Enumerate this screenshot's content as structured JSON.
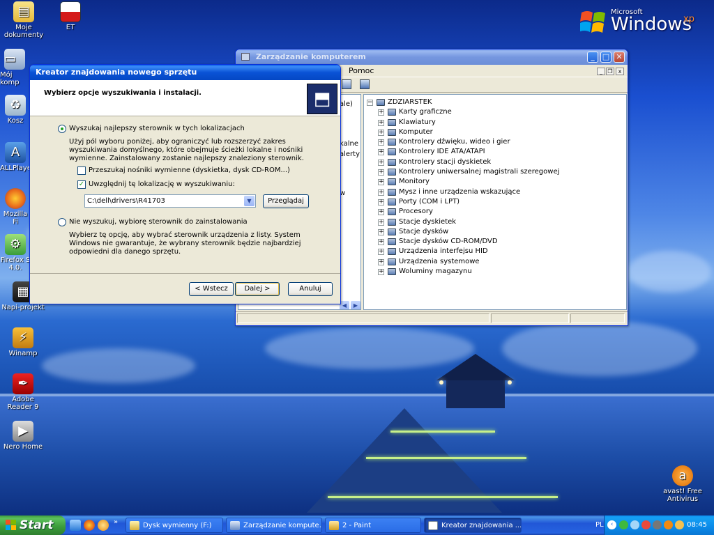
{
  "desktop": {
    "icons": [
      {
        "label": "Moje dokumenty",
        "icon": "my-documents-icon"
      },
      {
        "label": "ET",
        "icon": "flag-icon"
      },
      {
        "label": "Mój komp",
        "icon": "my-computer-icon"
      },
      {
        "label": "Kosz",
        "icon": "recycle-bin-icon"
      },
      {
        "label": "ALLPlayer",
        "icon": "allplayer-icon"
      },
      {
        "label": "Mozilla Fi",
        "icon": "firefox-icon"
      },
      {
        "label": "Firefox S 4.0.",
        "icon": "firefox-setup-icon"
      },
      {
        "label": "Napi-projekt",
        "icon": "napiprojekt-icon"
      },
      {
        "label": "Winamp",
        "icon": "winamp-icon"
      },
      {
        "label": "Adobe Reader 9",
        "icon": "adobe-reader-icon"
      },
      {
        "label": "Nero Home",
        "icon": "nero-icon"
      },
      {
        "label": "avast! Free Antivirus",
        "icon": "avast-icon"
      }
    ],
    "logo": {
      "ms": "Microsoft",
      "win": "Windows",
      "xp": "xp"
    }
  },
  "mmc": {
    "title": "Zarządzanie komputerem",
    "menu_help": "Pomoc",
    "left_fragments": [
      "ale)",
      "kalne",
      "alerty",
      "w"
    ],
    "root": "ZDZIARSTEK",
    "items": [
      "Karty graficzne",
      "Klawiatury",
      "Komputer",
      "Kontrolery dźwięku, wideo i gier",
      "Kontrolery IDE ATA/ATAPI",
      "Kontrolery stacji dyskietek",
      "Kontrolery uniwersalnej magistrali szeregowej",
      "Monitory",
      "Mysz i inne urządzenia wskazujące",
      "Porty (COM i LPT)",
      "Procesory",
      "Stacje dyskietek",
      "Stacje dysków",
      "Stacje dysków CD-ROM/DVD",
      "Urządzenia interfejsu HID",
      "Urządzenia systemowe",
      "Woluminy magazynu"
    ]
  },
  "wizard": {
    "title": "Kreator znajdowania nowego sprzętu",
    "heading": "Wybierz opcje wyszukiwania i instalacji.",
    "option1": "Wyszukaj najlepszy sterownik w tych lokalizacjach",
    "option1_desc": "Użyj pól wyboru poniżej, aby ograniczyć lub rozszerzyć zakres wyszukiwania domyślnego, które obejmuje ścieżki lokalne i nośniki wymienne. Zainstalowany zostanie najlepszy znaleziony sterownik.",
    "check1": "Przeszukaj nośniki wymienne (dyskietka, dysk CD-ROM...)",
    "check1_checked": false,
    "check2": "Uwzględnij tę lokalizację w wyszukiwaniu:",
    "check2_checked": true,
    "path": "C:\\dell\\drivers\\R41703",
    "browse": "Przeglądaj",
    "option2": "Nie wyszukuj, wybiorę sterownik do zainstalowania",
    "option2_desc": "Wybierz tę opcję, aby wybrać sterownik urządzenia z listy. System Windows nie gwarantuje, że wybrany sterownik będzie najbardziej odpowiedni dla danego sprzętu.",
    "back": "< Wstecz",
    "next": "Dalej >",
    "cancel": "Anuluj"
  },
  "taskbar": {
    "start": "Start",
    "tasks": [
      {
        "label": "Dysk wymienny (F:)",
        "active": false
      },
      {
        "label": "Zarządzanie kompute...",
        "active": false
      },
      {
        "label": "2 - Paint",
        "active": false
      },
      {
        "label": "Kreator znajdowania ...",
        "active": true
      }
    ],
    "lang": "PL",
    "clock": "08:45"
  }
}
